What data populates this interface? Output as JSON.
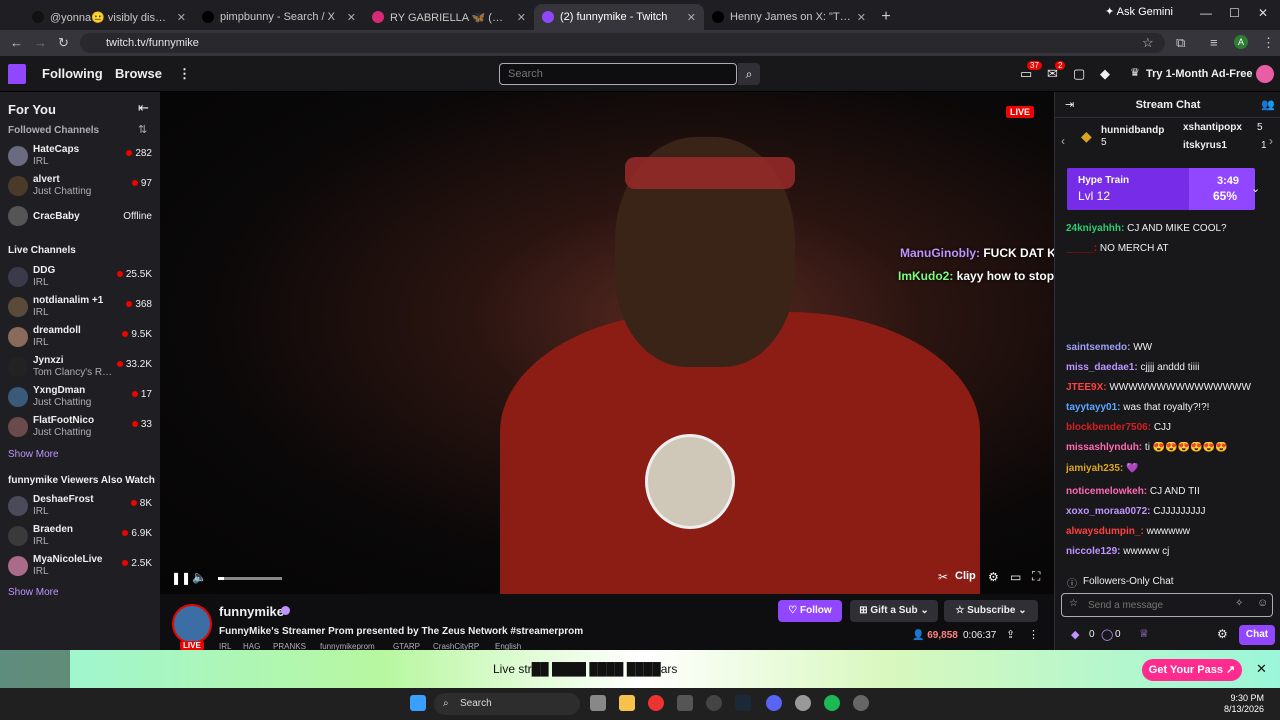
{
  "browser": {
    "tabs": [
      {
        "label": "@yonna😐 visibly disgusted at",
        "color": "#111"
      },
      {
        "label": "pimpbunny - Search / X",
        "color": "#000"
      },
      {
        "label": "RY GABRIELLA 🦋 (@ryygabriel",
        "color": "#d62976"
      },
      {
        "label": "(2) funnymike - Twitch",
        "color": "#9147ff"
      },
      {
        "label": "Henny James on X: \"That beer",
        "color": "#000"
      }
    ],
    "new_tab": "+",
    "gemini_label": "Ask Gemini",
    "url": "twitch.tv/funnymike"
  },
  "topnav": {
    "following": "Following",
    "browse": "Browse",
    "more": "⋮",
    "search_placeholder": "Search",
    "badge_inbox": "37",
    "badge_notif": "2",
    "adfree": "Try 1-Month Ad-Free"
  },
  "sidebar": {
    "for_you": "For You",
    "followed_title": "Followed Channels",
    "followed": [
      {
        "name": "HateCaps",
        "game": "IRL",
        "viewers": "282",
        "color": "#6a6a80"
      },
      {
        "name": "alvert",
        "game": "Just Chatting",
        "viewers": "97",
        "color": "#4a3a2a"
      },
      {
        "name": "CracBaby",
        "game": "",
        "viewers": "Offline",
        "color": "#555"
      }
    ],
    "live_title": "Live Channels",
    "live": [
      {
        "name": "DDG",
        "game": "IRL",
        "viewers": "25.5K",
        "color": "#3a3a4a"
      },
      {
        "name": "notdianalim +1",
        "game": "IRL",
        "viewers": "368",
        "color": "#5a4a3a"
      },
      {
        "name": "dreamdoll",
        "game": "IRL",
        "viewers": "9.5K",
        "color": "#8a6a5a"
      },
      {
        "name": "Jynxzi",
        "game": "Tom Clancy's Rainbow Six Siege",
        "viewers": "33.2K",
        "color": "#222"
      },
      {
        "name": "YxngDman",
        "game": "Just Chatting",
        "viewers": "17",
        "color": "#3a5a7a"
      },
      {
        "name": "FlatFootNico",
        "game": "Just Chatting",
        "viewers": "33",
        "color": "#6a4a4a"
      }
    ],
    "show_more_1": "Show More",
    "also_title": "funnymike Viewers Also Watch",
    "also": [
      {
        "name": "DeshaeFrost",
        "game": "IRL",
        "viewers": "8K",
        "color": "#4a4a5a"
      },
      {
        "name": "Braeden",
        "game": "IRL",
        "viewers": "6.9K",
        "color": "#3a3a3a"
      },
      {
        "name": "MyaNicoleLive",
        "game": "IRL",
        "viewers": "2.5K",
        "color": "#aa6a8a"
      }
    ],
    "show_more_2": "Show More"
  },
  "player": {
    "live_label": "LIVE",
    "overlay_chat": [
      {
        "user": "ManuGinobly:",
        "text": " FUCK DAT KEEP SMOKING",
        "color": "#bf94ff"
      },
      {
        "user": "ImKudo2:",
        "text": " kayy how to stop the lean",
        "color": "#7cfc7c"
      }
    ],
    "volume": 0.1,
    "clip_label": "Clip"
  },
  "channel": {
    "name": "funnymike",
    "live_label": "LIVE",
    "title": "FunnyMike's Streamer Prom presented by The Zeus Network #streamerprom",
    "tags": [
      "IRL",
      "HAG",
      "PRANKS",
      "funnymikeprom",
      "GTARP",
      "CrashCityRP",
      "English"
    ],
    "follow": "Follow",
    "gift": "Gift a Sub",
    "subscribe": "Subscribe",
    "viewers": "69,858",
    "uptime": "0:06:37"
  },
  "chat": {
    "header": "Stream Chat",
    "gifters": [
      {
        "name": "hunnidbandp",
        "count": "5"
      },
      {
        "name": "xshantipopx",
        "count": "5"
      },
      {
        "name": "itskyrus1",
        "count": "1"
      }
    ],
    "hype_title": "Hype Train",
    "hype_level": "Lvl 12",
    "hype_time": "3:49",
    "hype_progress": 65,
    "hype_percent": "65%",
    "messages": [
      {
        "user": "24kniyahhh:",
        "text": " CJ AND MIKE COOL?",
        "color": "#2ecc71"
      },
      {
        "user": "_____:",
        "text": " NO MERCH AT",
        "color": "#eb0400"
      },
      {
        "user": "saintsemedo:",
        "text": " WW",
        "color": "#9e9ef7"
      },
      {
        "user": "miss_daedae1:",
        "text": " cjjjj anddd tiiii",
        "color": "#bf94ff"
      },
      {
        "user": "JTEE9X:",
        "text": " WWWWWWWWWWWWWWW",
        "color": "#ff4040"
      },
      {
        "user": "tayytayy01:",
        "text": " was that royalty?!?!",
        "color": "#5aa7ff"
      },
      {
        "user": "blockbender7506:",
        "text": " CJJ",
        "color": "#d61f1f"
      },
      {
        "user": "missashlynduh:",
        "text": " ti 😍😍😍😍😍😍",
        "color": "#ff69b4"
      },
      {
        "user": "jamiyah235:",
        "text": " 💜",
        "color": "#daa520"
      },
      {
        "user": "noticemelowkeh:",
        "text": " CJ AND TII",
        "color": "#ff69b4"
      },
      {
        "user": "xoxo_moraa0072:",
        "text": " CJJJJJJJJJ",
        "color": "#bf94ff"
      },
      {
        "user": "alwaysdumpin_:",
        "text": " wwwwww",
        "color": "#ff4040"
      },
      {
        "user": "niccole129:",
        "text": " wwwww cj",
        "color": "#bf94ff"
      }
    ],
    "followers_only": "Followers-Only Chat",
    "input_placeholder": "Send a message",
    "points_1": "0",
    "points_2": "0",
    "chat_button": "Chat"
  },
  "ad": {
    "text": "Live str██ ████ ████ ████ars",
    "cta": "Get Your Pass ↗",
    "close": "✕"
  },
  "taskbar": {
    "search": "Search",
    "time": "9:30 PM",
    "date": "8/13/2026"
  }
}
